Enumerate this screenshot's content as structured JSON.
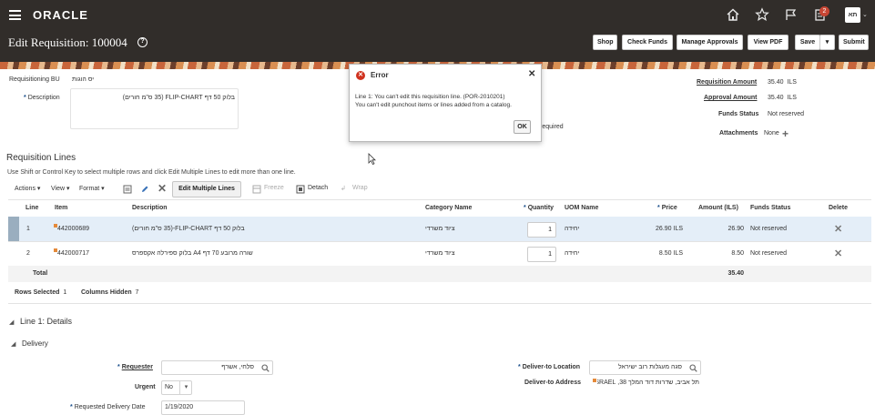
{
  "global": {
    "logo": "ORACLE",
    "notifications_count": "2",
    "user_initials": "תא"
  },
  "header": {
    "title": "Edit Requisition: 100004",
    "buttons": {
      "shop": "Shop",
      "check_funds": "Check Funds",
      "manage_approvals": "Manage Approvals",
      "view_pdf": "View PDF",
      "save": "Save",
      "submit": "Submit"
    }
  },
  "fields": {
    "requisitioning_bu_label": "Requisitioning BU",
    "requisitioning_bu_value": "יס הוגות",
    "description_label": "Description",
    "description_value": "בלוק 50 דף FLIP-CHART (35 ס\"מ חורים)",
    "partial_text": "required",
    "requisition_amount_label": "Requisition Amount",
    "requisition_amount_value": "35.40",
    "requisition_amount_currency": "ILS",
    "approval_amount_label": "Approval Amount",
    "approval_amount_value": "35.40",
    "approval_amount_currency": "ILS",
    "funds_status_label": "Funds Status",
    "funds_status_value": "Not reserved",
    "attachments_label": "Attachments",
    "attachments_value": "None"
  },
  "lines": {
    "title": "Requisition Lines",
    "hint": "Use Shift or Control Key to select multiple rows and click Edit Multiple Lines to edit more than one line.",
    "toolbar": {
      "actions": "Actions",
      "view": "View",
      "format": "Format",
      "edit_multiple": "Edit Multiple Lines",
      "freeze": "Freeze",
      "detach": "Detach",
      "wrap": "Wrap"
    },
    "columns": [
      "Line",
      "Item",
      "Description",
      "Category Name",
      "Quantity",
      "UOM Name",
      "Price",
      "Amount (ILS)",
      "Funds Status",
      "Delete"
    ],
    "rows": [
      {
        "line": "1",
        "item": "442000689",
        "description": "בלוק 50 דף FLIP-CHART-(35 ס\"מ חורים)",
        "category": "ציוד משרדי",
        "quantity": "1",
        "uom": "יחידה",
        "price": "26.90 ILS",
        "amount": "26.90",
        "funds_status": "Not reserved"
      },
      {
        "line": "2",
        "item": "442000717",
        "description": "שורה מרובע 70 דף A4 בלוק ספירלה אקספרס",
        "category": "ציוד משרדי",
        "quantity": "1",
        "uom": "יחידה",
        "price": "8.50 ILS",
        "amount": "8.50",
        "funds_status": "Not reserved"
      }
    ],
    "total_label": "Total",
    "total_value": "35.40",
    "rows_selected_label": "Rows Selected",
    "rows_selected_value": "1",
    "columns_hidden_label": "Columns Hidden",
    "columns_hidden_value": "7"
  },
  "details": {
    "title": "Line 1: Details",
    "delivery_title": "Delivery",
    "requester_label": "Requester",
    "requester_value": "סלחי, אשרף",
    "urgent_label": "Urgent",
    "urgent_value": "No",
    "requested_delivery_label": "Requested Delivery Date",
    "requested_delivery_value": "1/19/2020",
    "deliver_to_location_label": "Deliver-to Location",
    "deliver_to_location_value": "סגה מעגלות רוב ישיראל",
    "deliver_to_address_label": "Deliver-to Address",
    "deliver_to_address_value": "תל אביב, שדרות דוד המלך 38, ISRAEL"
  },
  "dialog": {
    "title": "Error",
    "line1": "Line 1: You can't edit this requisition line. (POR-2010201)",
    "line2": "You can't edit punchout items or lines added from a catalog.",
    "ok": "OK"
  }
}
